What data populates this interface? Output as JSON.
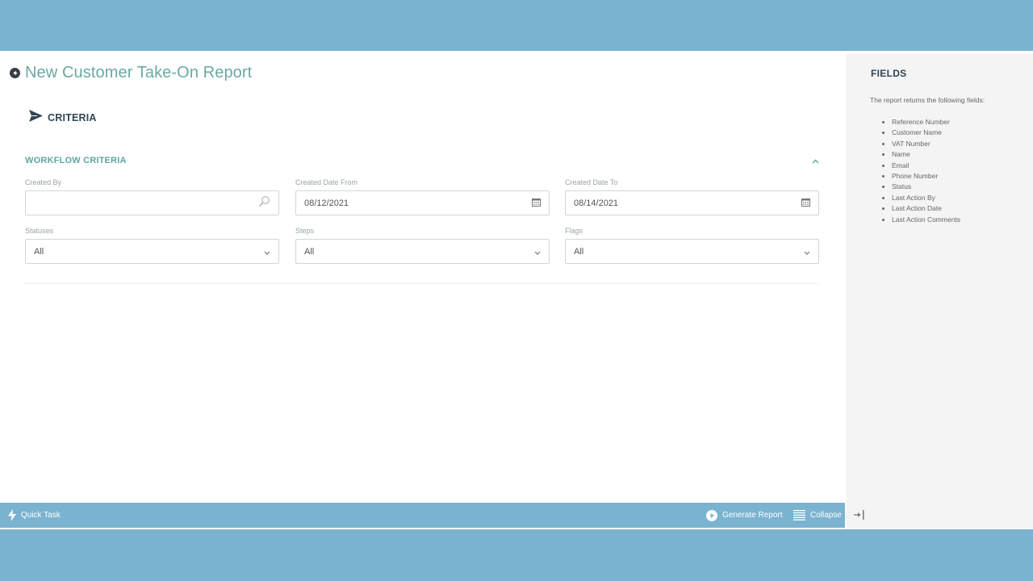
{
  "page": {
    "title": "New Customer Take-On Report"
  },
  "criteria": {
    "heading": "CRITERIA"
  },
  "workflow": {
    "section_title": "WORKFLOW CRITERIA",
    "created_by": {
      "label": "Created By",
      "value": ""
    },
    "created_from": {
      "label": "Created Date From",
      "value": "08/12/2021"
    },
    "created_to": {
      "label": "Created Date To",
      "value": "08/14/2021"
    },
    "statuses": {
      "label": "Statuses",
      "value": "All"
    },
    "steps": {
      "label": "Steps",
      "value": "All"
    },
    "flags": {
      "label": "Flags",
      "value": "All"
    }
  },
  "toolbar": {
    "quick_task": "Quick Task",
    "generate_report": "Generate Report",
    "collapse": "Collapse"
  },
  "sidebar": {
    "title": "FIELDS",
    "description": "The report returns the following fields:",
    "fields": [
      "Reference Number",
      "Customer Name",
      "VAT Number",
      "Name",
      "Email",
      "Phone Number",
      "Status",
      "Last Action By",
      "Last Action Date",
      "Last Action Comments"
    ]
  },
  "colors": {
    "band": "#7ab3cf",
    "accent": "#6aa9a1",
    "heading_dark": "#2f4556",
    "sidebar_bg": "#f4f4f4"
  }
}
